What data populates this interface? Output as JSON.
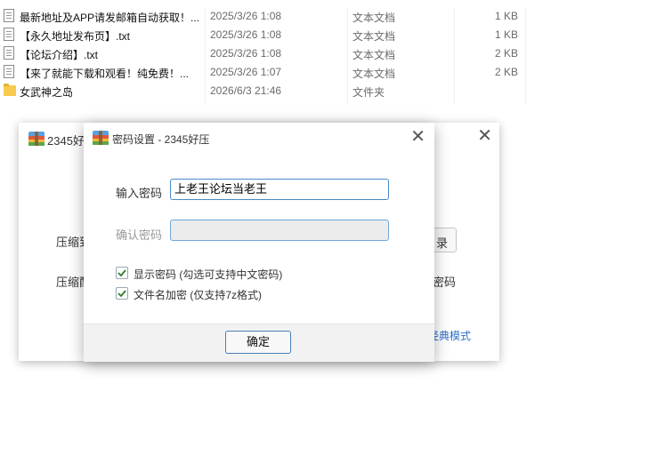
{
  "files": [
    {
      "name": "最新地址及APP请发邮箱自动获取！...",
      "date": "2025/3/26 1:08",
      "type": "文本文档",
      "size": "1 KB",
      "icon": "text-file-icon"
    },
    {
      "name": "【永久地址发布页】.txt",
      "date": "2025/3/26 1:08",
      "type": "文本文档",
      "size": "1 KB",
      "icon": "text-file-icon"
    },
    {
      "name": "【论坛介绍】.txt",
      "date": "2025/3/26 1:08",
      "type": "文本文档",
      "size": "2 KB",
      "icon": "text-file-icon"
    },
    {
      "name": "【来了就能下载和观看！纯免费！...",
      "date": "2025/3/26 1:07",
      "type": "文本文档",
      "size": "2 KB",
      "icon": "text-file-icon"
    },
    {
      "name": "女武神之岛",
      "date": "2026/6/3 21:46",
      "type": "文件夹",
      "size": "",
      "icon": "folder-icon"
    }
  ],
  "back_window": {
    "title": "2345好",
    "label_1": "压缩到",
    "label_2": "压缩配",
    "button_fragment": "录",
    "right_text": "密码",
    "link": "经典模式"
  },
  "dialog": {
    "title": "密码设置 - 2345好压",
    "password_label": "输入密码",
    "password_value": "上老王论坛当老王",
    "confirm_label": "确认密码",
    "confirm_value": "",
    "checkbox_show_password": {
      "label": "显示密码 (勾选可支持中文密码)",
      "checked": true
    },
    "checkbox_encrypt_names": {
      "label": "文件名加密 (仅支持7z格式)",
      "checked": true
    },
    "ok_button": "确定"
  },
  "colors": {
    "accent": "#4a8ac9",
    "link": "#2f6fc9",
    "folder": "#f8c94f",
    "checkmark": "#2e7d32"
  }
}
